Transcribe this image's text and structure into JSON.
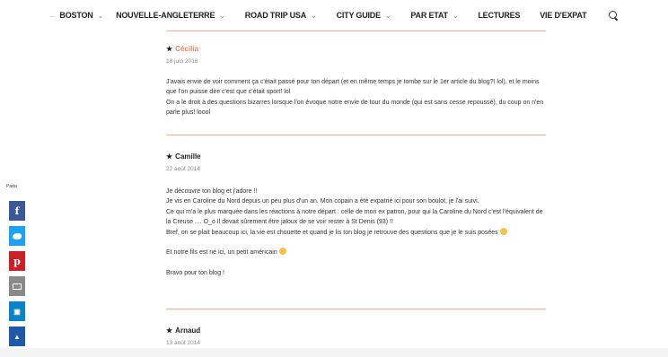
{
  "nav": {
    "items": [
      {
        "label": "BOSTON",
        "prefix": "←",
        "chevron": true
      },
      {
        "label": "NOUVELLE-ANGLETERRE",
        "chevron": true
      },
      {
        "label": "ROAD TRIP USA",
        "chevron": true
      },
      {
        "label": "CITY GUIDE",
        "chevron": true
      },
      {
        "label": "PAR ETAT",
        "chevron": true
      },
      {
        "label": "LECTURES",
        "chevron": false
      },
      {
        "label": "VIE D'EXPAT",
        "chevron": false
      }
    ],
    "search_icon": "search-icon"
  },
  "share": {
    "label": "Parta",
    "buttons": [
      "facebook-icon",
      "twitter-icon",
      "pinterest-icon",
      "email-icon",
      "flipboard-icon",
      "more-icon"
    ]
  },
  "comments": [
    {
      "author": "Cécilia",
      "date": "18 juin 2016",
      "paragraphs": [
        "J'avais envie de voir comment ça c'était passé pour ton départ (et en même temps je tombe sur le 1er article du blog?! lol), et le moins que l'on puisse dire c'est que c'était sport! lol\nOn a le droit à des questions bizarres lorsque l'on évoque notre envie de tour du monde (qui est sans cesse repoussé), du coup on n'en parle plus! loool"
      ]
    },
    {
      "author": "Camille",
      "date": "22 août 2014",
      "paragraphs": [
        "Je découvre ton blog et j'adore !!\nJe vis en Caroline du Nord depuis un peu plus d'un an. Mon copain a été expatrié ici pour son boulot, je l'ai suivi.\nCe qui m'a le plus marquée dans les réactions à notre départ : celle de mon ex patron, pour qui la Caroline du Nord c'est l'équivalent de la Creuse .... O_o Il devait sûrement être jaloux de se voir rester à St Denis (93) !!\nBref, on se plait beaucoup ici, la vie est chouette et quand je lis ton blog je retrouve des questions que je le suis posées",
        "Et notre fils est né ici, un petit américain",
        "Bravo pour ton blog !"
      ]
    },
    {
      "author": "Arnaud",
      "date": "13 août 2014",
      "paragraphs": []
    }
  ]
}
